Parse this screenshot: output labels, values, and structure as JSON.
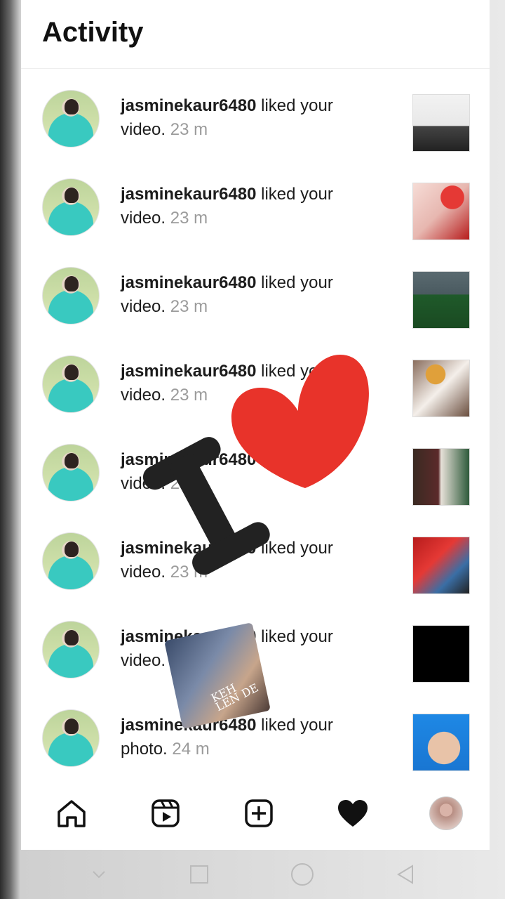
{
  "header": {
    "title": "Activity"
  },
  "notifications": [
    {
      "user": "jasminekaur6480",
      "action": " liked your",
      "object": "video.",
      "time": "23 m",
      "thumb": "bike"
    },
    {
      "user": "jasminekaur6480",
      "action": " liked your",
      "object": "video.",
      "time": "23 m",
      "thumb": "couple-red"
    },
    {
      "user": "jasminekaur6480",
      "action": " liked your",
      "object": "video.",
      "time": "23 m",
      "thumb": "man-green"
    },
    {
      "user": "jasminekaur6480",
      "action": " liked your",
      "object": "video.",
      "time": "23 m",
      "thumb": "turban-man"
    },
    {
      "user": "jasminekaur6480",
      "action": " liked your",
      "object": "video.",
      "time": "23 m",
      "thumb": "couple-dark"
    },
    {
      "user": "jasminekaur6480",
      "action": " liked your",
      "object": "video.",
      "time": "23 m",
      "thumb": "couple-red-2"
    },
    {
      "user": "jasminekaur6480",
      "action": " liked your",
      "object": "video.",
      "time": "23 m",
      "thumb": "black"
    },
    {
      "user": "jasminekaur6480",
      "action": " liked your",
      "object": "photo.",
      "time": "24 m",
      "thumb": "face"
    }
  ],
  "bottom_nav": [
    {
      "name": "home-icon"
    },
    {
      "name": "reels-icon"
    },
    {
      "name": "create-icon"
    },
    {
      "name": "heart-icon"
    },
    {
      "name": "profile-icon"
    }
  ],
  "overlay": {
    "letter": "I",
    "sticker_text": "KEH LEN DE"
  },
  "colors": {
    "heart": "#e8332a",
    "text": "#1c1c1c",
    "muted": "#9b9b9b"
  }
}
